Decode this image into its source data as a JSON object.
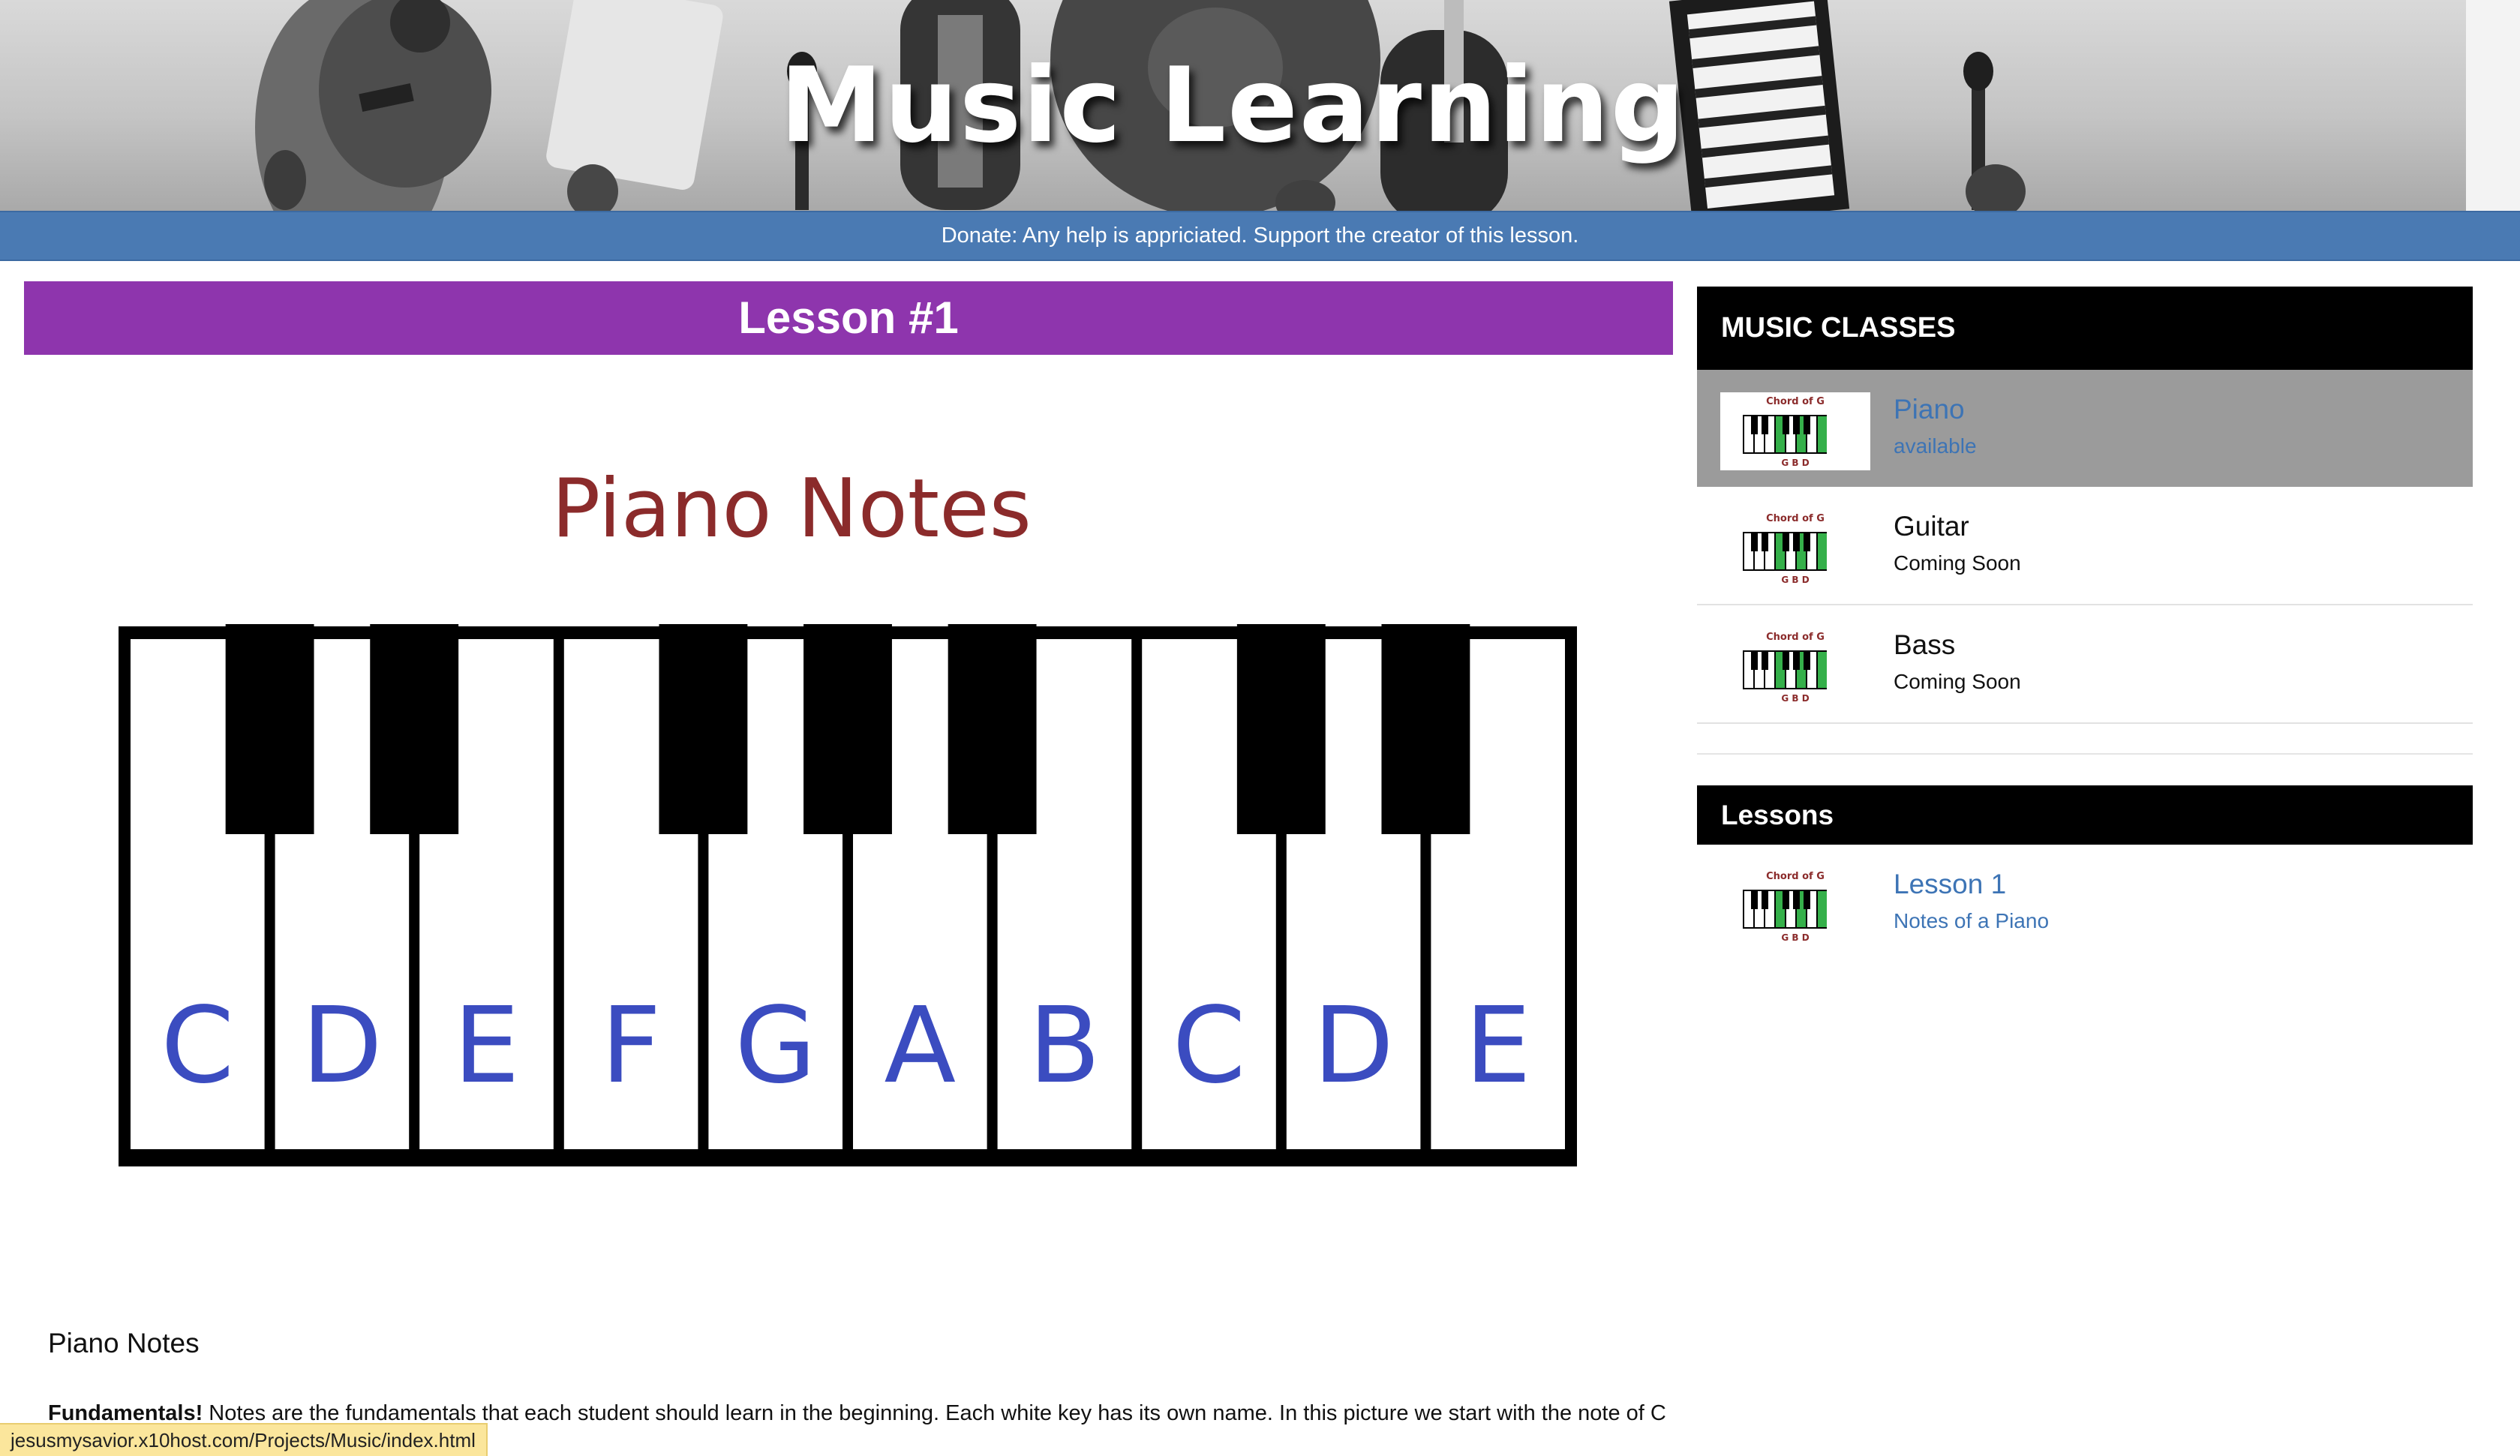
{
  "header": {
    "title": "Music Learning"
  },
  "donate": {
    "text": "Donate: Any help is appriciated. Support the creator of this lesson."
  },
  "lesson": {
    "header": "Lesson #1",
    "figure": {
      "title": "Piano Notes",
      "note_labels": [
        "C",
        "D",
        "E",
        "F",
        "G",
        "A",
        "B",
        "C",
        "D",
        "E"
      ],
      "title_color": "#8b2b2b",
      "note_color": "#3b4cc0"
    },
    "section_heading": "Piano Notes",
    "paragraph_bold": "Fundamentals!",
    "paragraph_text": " Notes are the fundamentals that each student should learn in the beginning. Each white key has its own name. In this picture we start with the note of C"
  },
  "sidebar": {
    "classes_header": "MUSIC CLASSES",
    "classes": [
      {
        "title": "Piano",
        "status": "available",
        "active": true
      },
      {
        "title": "Guitar",
        "status": "Coming Soon",
        "active": false
      },
      {
        "title": "Bass",
        "status": "Coming Soon",
        "active": false
      }
    ],
    "lessons_header": "Lessons",
    "lessons": [
      {
        "title": "Lesson 1",
        "subtitle": "Notes of a Piano"
      }
    ],
    "thumbnail": {
      "caption": "Chord of G",
      "notes": "G  B  D"
    }
  },
  "status_bar": {
    "url": "jesusmysavior.x10host.com/Projects/Music/index.html"
  },
  "colors": {
    "donate_bar": "#4a7ab3",
    "lesson_header": "#8e35ad",
    "link_blue": "#3d74b5",
    "active_item": "#9b9b9b",
    "thumb_green": "#35b04a"
  }
}
